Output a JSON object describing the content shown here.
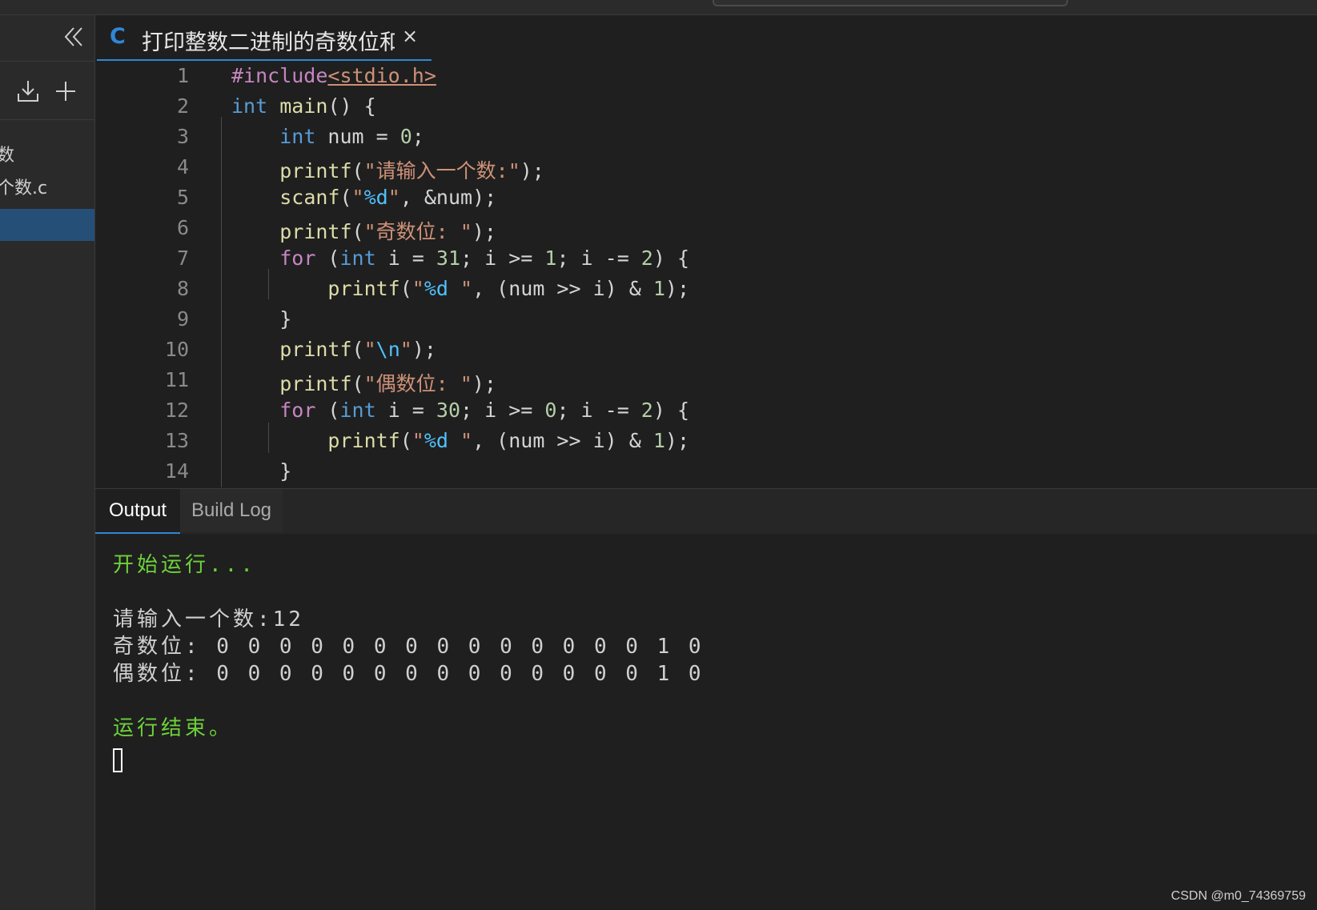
{
  "tab": {
    "title": "打印整数二进制的奇数位和偶数位.c",
    "close": "×",
    "icon_letter": "C",
    "icon": "c-language-icon"
  },
  "sidebar": {
    "items": [
      {
        "label": "数"
      },
      {
        "label": "个数.c"
      }
    ]
  },
  "editor": {
    "line_numbers": [
      "1",
      "2",
      "3",
      "4",
      "5",
      "6",
      "7",
      "8",
      "9",
      "10",
      "11",
      "12",
      "13",
      "14"
    ]
  },
  "panel": {
    "tabs": [
      {
        "label": "Output",
        "active": true
      },
      {
        "label": "Build Log",
        "active": false
      }
    ]
  },
  "output": {
    "start": "开始运行...",
    "prompt": "请输入一个数:12",
    "odd": "奇数位: 0 0 0 0 0 0 0 0 0 0 0 0 0 0 1 0",
    "even": "偶数位: 0 0 0 0 0 0 0 0 0 0 0 0 0 0 1 0",
    "end": "运行结束。"
  },
  "watermark": "CSDN @m0_74369759",
  "colors": {
    "accent": "#2f87d8",
    "output_green": "#6dd13a",
    "selection": "#264f78"
  }
}
